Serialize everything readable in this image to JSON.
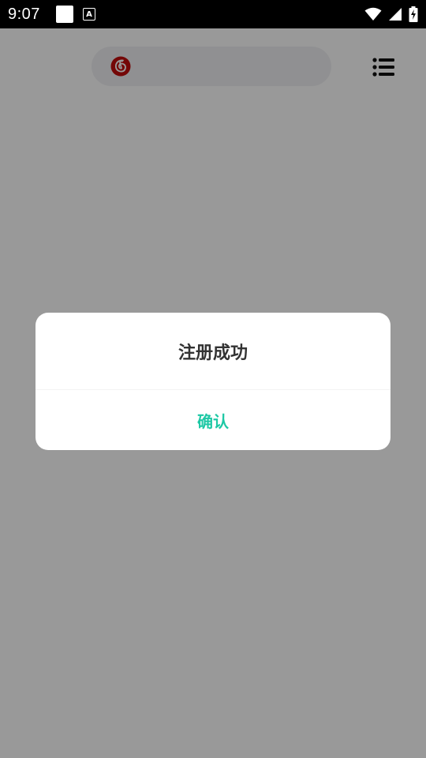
{
  "status_bar": {
    "time": "9:07",
    "notif_letter": "A"
  },
  "app": {
    "logo_color": "#c20c0c",
    "search_bg": "#f0f1f3"
  },
  "dialog": {
    "title": "注册成功",
    "confirm_label": "确认",
    "accent_color": "#1ec8a5"
  }
}
